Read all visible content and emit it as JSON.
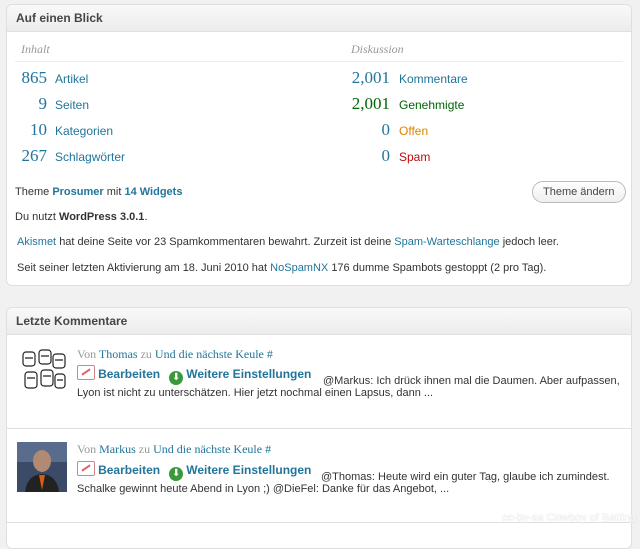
{
  "glance": {
    "title": "Auf einen Blick",
    "content_heading": "Inhalt",
    "discussion_heading": "Diskussion",
    "content_rows": [
      {
        "count": "865",
        "label": "Artikel"
      },
      {
        "count": "9",
        "label": "Seiten"
      },
      {
        "count": "10",
        "label": "Kategorien"
      },
      {
        "count": "267",
        "label": "Schlagwörter"
      }
    ],
    "discussion_rows": [
      {
        "count": "2,001",
        "label": "Kommentare"
      },
      {
        "count": "2,001",
        "label": "Genehmigte"
      },
      {
        "count": "0",
        "label": "Offen"
      },
      {
        "count": "0",
        "label": "Spam"
      }
    ],
    "theme_prefix": "Theme",
    "theme_name": "Prosumer",
    "theme_mid": "mit",
    "widgets_link": "14 Widgets",
    "change_theme_button": "Theme ändern",
    "version_prefix": "Du nutzt",
    "version_name": "WordPress 3.0.1",
    "version_suffix": ".",
    "akismet_link": "Akismet",
    "akismet_text1": "hat deine Seite vor 23 Spamkommentaren bewahrt. Zurzeit ist deine",
    "spam_queue_link": "Spam-Warteschlange",
    "akismet_text2": "jedoch leer.",
    "nospam_text1": "Seit seiner letzten Aktivierung am 18. Juni 2010 hat",
    "nospam_link": "NoSpamNX",
    "nospam_text2": "176 dumme Spambots gestoppt (2 pro Tag)."
  },
  "recent_comments": {
    "title": "Letzte Kommentare",
    "comments": [
      {
        "from": "Von",
        "author": "Thomas",
        "on": "zu",
        "post": "Und die nächste Keule",
        "hash": "#",
        "edit_label": "Bearbeiten",
        "more_label": "Weitere Einstellungen",
        "excerpt_line1": "@Markus: Ich drück ihnen mal die Daumen. Aber aufpassen,",
        "excerpt_line2": "Lyon ist nicht zu unterschätzen. Hier jetzt nochmal einen Lapsus, dann ..."
      },
      {
        "from": "Von",
        "author": "Markus",
        "on": "zu",
        "post": "Und die nächste Keule",
        "hash": "#",
        "edit_label": "Bearbeiten",
        "more_label": "Weitere Einstellungen",
        "excerpt_line1": "@Thomas: Heute wird ein guter Tag, glaube ich zumindest.",
        "excerpt_line2": "Schalke gewinnt heute Abend in Lyon ;) @DieFel: Danke für das Angebot, ..."
      }
    ]
  },
  "watermark": "cc-by-sa Cowboy of Batting",
  "colors": {
    "link": "#21759b",
    "approved": "#006505",
    "pending": "#d98500",
    "spam": "#bc0b0b"
  }
}
